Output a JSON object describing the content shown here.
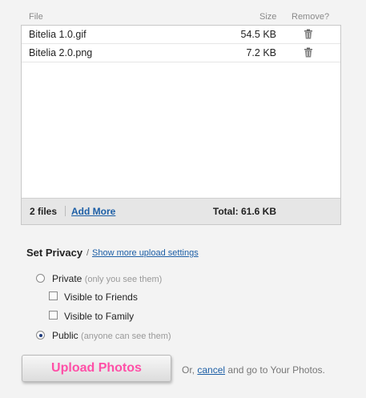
{
  "headers": {
    "file": "File",
    "size": "Size",
    "remove": "Remove?"
  },
  "files": [
    {
      "name": "Bitelia 1.0.gif",
      "size": "54.5 KB"
    },
    {
      "name": "Bitelia 2.0.png",
      "size": "7.2 KB"
    }
  ],
  "footer": {
    "count": "2 files",
    "add_more": "Add More",
    "total": "Total: 61.6 KB"
  },
  "privacy": {
    "title": "Set Privacy",
    "slash": "/",
    "more_link": "Show more upload settings",
    "private_label": "Private",
    "private_hint": "(only you see them)",
    "friends_label": "Visible to Friends",
    "family_label": "Visible to Family",
    "public_label": "Public",
    "public_hint": "(anyone can see them)",
    "selected": "public"
  },
  "actions": {
    "upload_label": "Upload Photos",
    "or_text": "Or,",
    "cancel_link": "cancel",
    "after_text": "and go to Your Photos."
  },
  "colors": {
    "link": "#1d5fa6",
    "upload_text": "#ff4fa7"
  },
  "icons": {
    "remove": "trash-icon"
  }
}
